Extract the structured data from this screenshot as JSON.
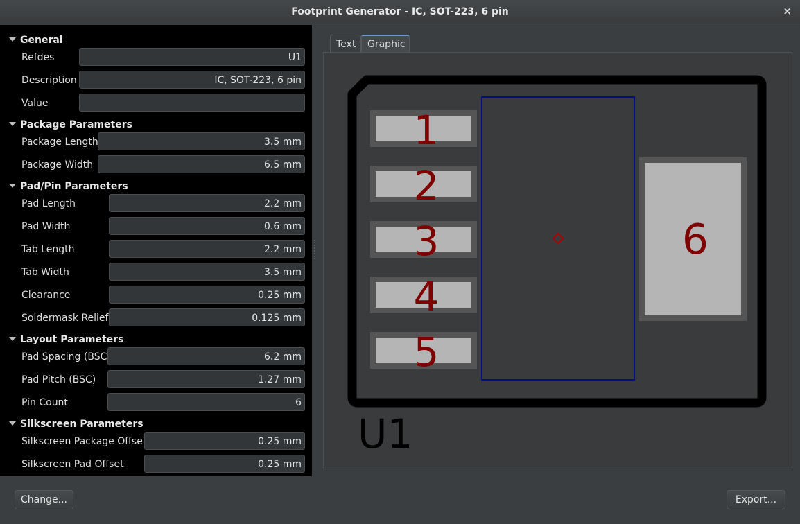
{
  "window": {
    "title": "Footprint Generator - IC, SOT-223, 6 pin",
    "close_glyph": "×"
  },
  "sections": {
    "general": {
      "label": "General"
    },
    "package": {
      "label": "Package Parameters"
    },
    "pad": {
      "label": "Pad/Pin Parameters"
    },
    "layout": {
      "label": "Layout Parameters"
    },
    "silk": {
      "label": "Silkscreen Parameters"
    }
  },
  "fields": {
    "refdes": {
      "label": "Refdes",
      "value": "U1"
    },
    "description": {
      "label": "Description",
      "value": "IC, SOT-223, 6 pin"
    },
    "value": {
      "label": "Value",
      "value": ""
    },
    "package_length": {
      "label": "Package Length",
      "value": "3.5 mm"
    },
    "package_width": {
      "label": "Package Width",
      "value": "6.5 mm"
    },
    "pad_length": {
      "label": "Pad Length",
      "value": "2.2 mm"
    },
    "pad_width": {
      "label": "Pad Width",
      "value": "0.6 mm"
    },
    "tab_length": {
      "label": "Tab Length",
      "value": "2.2 mm"
    },
    "tab_width": {
      "label": "Tab Width",
      "value": "3.5 mm"
    },
    "clearance": {
      "label": "Clearance",
      "value": "0.25 mm"
    },
    "soldermask_relief": {
      "label": "Soldermask Relief",
      "value": "0.125 mm"
    },
    "pad_spacing": {
      "label": "Pad Spacing (BSC)",
      "value": "6.2 mm"
    },
    "pad_pitch": {
      "label": "Pad Pitch (BSC)",
      "value": "1.27 mm"
    },
    "pin_count": {
      "label": "Pin Count",
      "value": "6"
    },
    "silk_package_offset": {
      "label": "Silkscreen Package Offset",
      "value": "0.25 mm"
    },
    "silk_pad_offset": {
      "label": "Silkscreen Pad Offset",
      "value": "0.25 mm"
    }
  },
  "tabs": {
    "text": "Text",
    "graphic": "Graphic",
    "active": "Graphic"
  },
  "preview": {
    "refdes": "U1",
    "pins": [
      "1",
      "2",
      "3",
      "4",
      "5"
    ],
    "tab_pin": "6",
    "colors": {
      "silkscreen": "#000000",
      "pad": "#b5b5b5",
      "mask": "#555555",
      "courtyard": "#000f8a",
      "pin_number": "#800000",
      "origin": "#b00000"
    }
  },
  "buttons": {
    "change": "Change...",
    "export": "Export..."
  }
}
